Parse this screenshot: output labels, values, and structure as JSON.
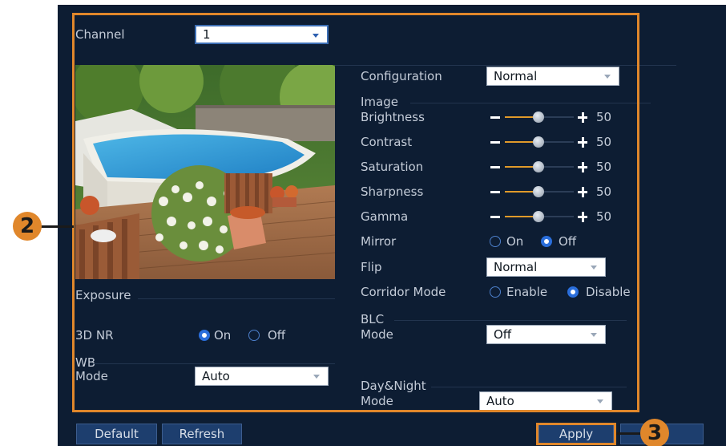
{
  "channel": {
    "label": "Channel",
    "value": "1"
  },
  "preview": {
    "alt": "camera-preview"
  },
  "exposure": {
    "label": "Exposure"
  },
  "nr3d": {
    "label": "3D NR",
    "on": "On",
    "off": "Off",
    "selected": "On"
  },
  "wb": {
    "section": "WB",
    "mode_label": "Mode",
    "mode_value": "Auto"
  },
  "configuration": {
    "label": "Configuration",
    "value": "Normal"
  },
  "image": {
    "section": "Image",
    "sliders": [
      {
        "label": "Brightness",
        "value": "50"
      },
      {
        "label": "Contrast",
        "value": "50"
      },
      {
        "label": "Saturation",
        "value": "50"
      },
      {
        "label": "Sharpness",
        "value": "50"
      },
      {
        "label": "Gamma",
        "value": "50"
      }
    ]
  },
  "mirror": {
    "label": "Mirror",
    "on": "On",
    "off": "Off",
    "selected": "Off"
  },
  "flip": {
    "label": "Flip",
    "value": "Normal"
  },
  "corridor": {
    "label": "Corridor Mode",
    "enable": "Enable",
    "disable": "Disable",
    "selected": "Disable"
  },
  "blc": {
    "section": "BLC",
    "mode_label": "Mode",
    "mode_value": "Off"
  },
  "daynight": {
    "section": "Day&Night",
    "mode_label": "Mode",
    "mode_value": "Auto"
  },
  "buttons": {
    "default": "Default",
    "refresh": "Refresh",
    "apply": "Apply",
    "cancel": ""
  },
  "callouts": {
    "two": "2",
    "three": "3"
  },
  "colors": {
    "background": "#0d1d33",
    "accent": "#e0872b",
    "button": "#1d3e6e",
    "radio": "#2a6edb"
  }
}
